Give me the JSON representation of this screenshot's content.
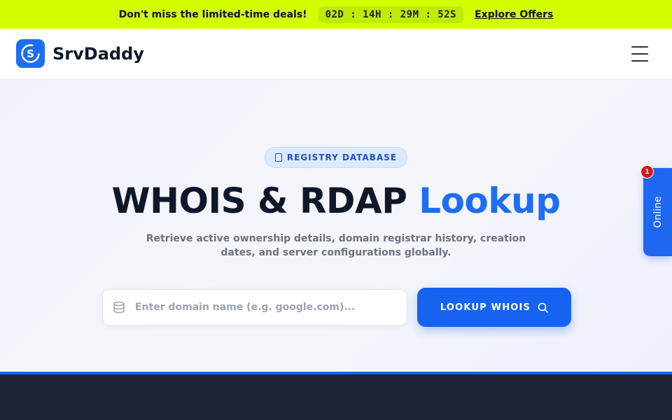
{
  "promo": {
    "text": "Don't miss the limited-time deals!",
    "countdown": "02D : 14H : 29M : 52S",
    "link": "Explore Offers"
  },
  "brand": {
    "logo_letter": "S",
    "name": "SrvDaddy"
  },
  "hero": {
    "badge": "REGISTRY DATABASE",
    "title_main": "WHOIS & RDAP ",
    "title_accent": "Lookup",
    "subtitle": "Retrieve active ownership details, domain registrar history, creation dates, and server configurations globally."
  },
  "search": {
    "placeholder": "Enter domain name (e.g. google.com)...",
    "value": "",
    "button_label": "LOOKUP WHOIS"
  },
  "chat_widget": {
    "label": "Online",
    "notification_count": "1"
  },
  "colors": {
    "promo_bg": "#d2ff00",
    "accent": "#1d6ef5",
    "button": "#1663f2",
    "dark_footer": "#1d2234",
    "badge_red": "#d21b1b"
  },
  "icons": {
    "menu": "hamburger-menu-icon",
    "badge": "database-icon",
    "search_field": "database-icon",
    "button": "search-icon"
  }
}
